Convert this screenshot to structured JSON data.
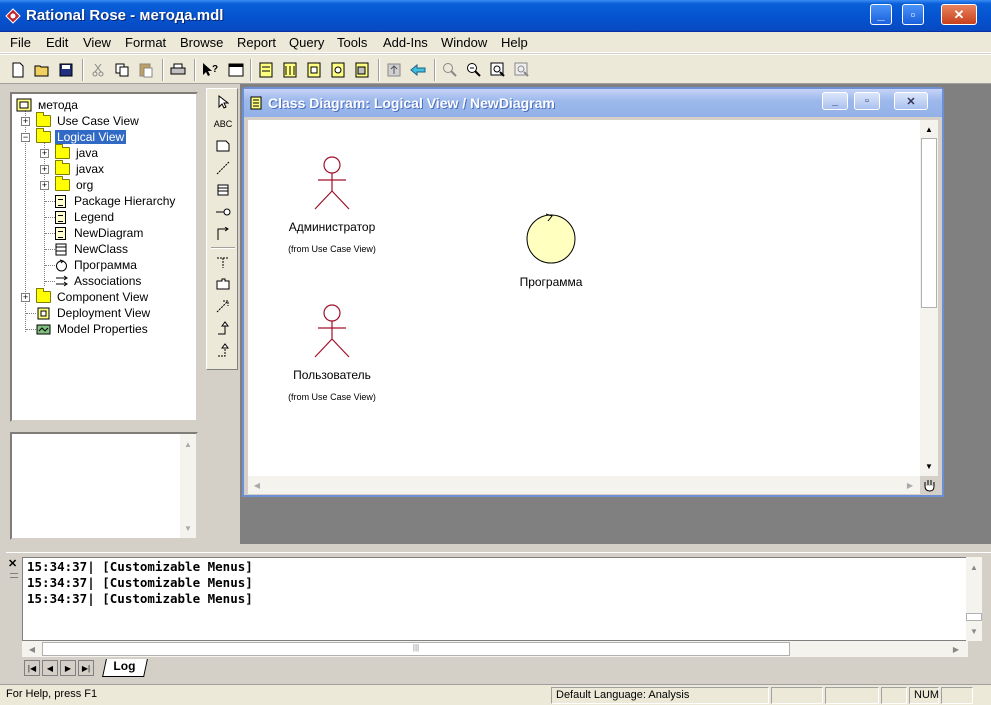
{
  "app": {
    "title": "Rational Rose - метода.mdl"
  },
  "menu": [
    "File",
    "Edit",
    "View",
    "Format",
    "Browse",
    "Report",
    "Query",
    "Tools",
    "Add-Ins",
    "Window",
    "Help"
  ],
  "tree": {
    "root": "метода",
    "items": [
      {
        "label": "Use Case View"
      },
      {
        "label": "Logical View"
      },
      {
        "label": "java"
      },
      {
        "label": "javax"
      },
      {
        "label": "org"
      },
      {
        "label": "Package Hierarchy"
      },
      {
        "label": "Legend"
      },
      {
        "label": "NewDiagram"
      },
      {
        "label": "NewClass"
      },
      {
        "label": "Программа"
      },
      {
        "label": "Associations"
      },
      {
        "label": "Component View"
      },
      {
        "label": "Deployment View"
      },
      {
        "label": "Model Properties"
      }
    ]
  },
  "toolbox": {
    "text_tool": "ABC"
  },
  "diagram": {
    "title": "Class Diagram: Logical View / NewDiagram",
    "actors": [
      {
        "name": "Администратор",
        "from": "(from Use Case View)"
      },
      {
        "name": "Пользователь",
        "from": "(from Use Case View)"
      }
    ],
    "control": {
      "name": "Программа"
    }
  },
  "log": {
    "lines": [
      "15:34:37|  [Customizable Menus]",
      "15:34:37|  [Customizable Menus]",
      "15:34:37|  [Customizable Menus]"
    ],
    "tab": "Log"
  },
  "status": {
    "help": "For Help, press F1",
    "language": "Default Language: Analysis",
    "num": "NUM"
  }
}
